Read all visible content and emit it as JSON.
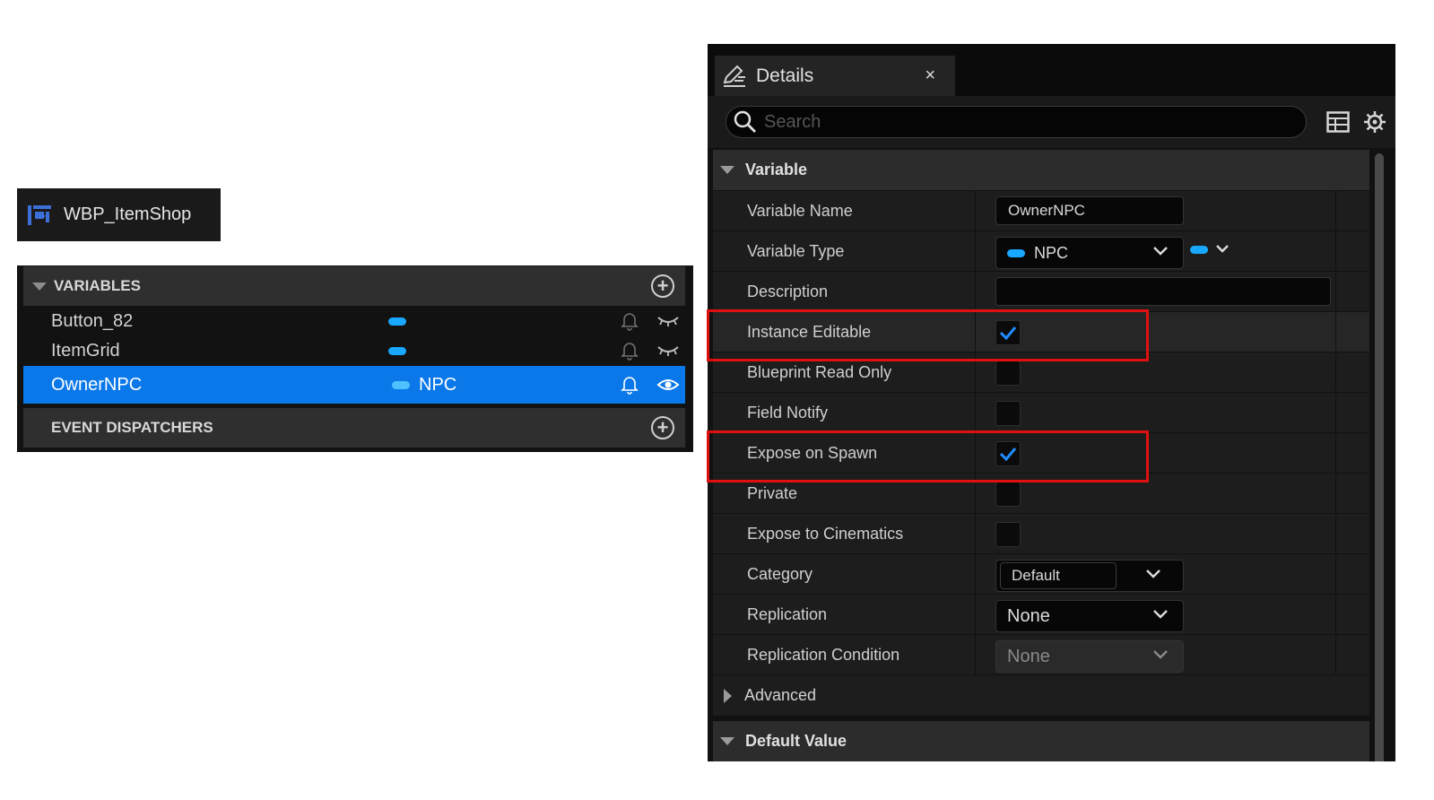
{
  "blueprint_tab": {
    "title": "WBP_ItemShop",
    "icon": "widget-blueprint-icon"
  },
  "my_blueprint": {
    "variables_header": "VARIABLES",
    "variables": [
      {
        "name": "Button_82",
        "type": "",
        "selected": false,
        "visibility": "eye-closed"
      },
      {
        "name": "ItemGrid",
        "type": "",
        "selected": false,
        "visibility": "eye-closed"
      },
      {
        "name": "OwnerNPC",
        "type": "NPC",
        "selected": true,
        "visibility": "eye-open"
      }
    ],
    "event_dispatchers_header": "EVENT DISPATCHERS",
    "accent_color": "#0a78e8",
    "type_pill_color": "#19a8ff"
  },
  "details": {
    "tab_title": "Details",
    "close_glyph": "×",
    "search_placeholder": "Search",
    "section_variable": "Variable",
    "properties": {
      "variable_name": {
        "label": "Variable Name",
        "value": "OwnerNPC"
      },
      "variable_type": {
        "label": "Variable Type",
        "value": "NPC"
      },
      "description": {
        "label": "Description",
        "value": ""
      },
      "instance_editable": {
        "label": "Instance Editable",
        "checked": true
      },
      "blueprint_read_only": {
        "label": "Blueprint Read Only",
        "checked": false
      },
      "field_notify": {
        "label": "Field Notify",
        "checked": false
      },
      "expose_on_spawn": {
        "label": "Expose on Spawn",
        "checked": true
      },
      "private": {
        "label": "Private",
        "checked": false
      },
      "expose_to_cinematics": {
        "label": "Expose to Cinematics",
        "checked": false
      },
      "category": {
        "label": "Category",
        "value": "Default"
      },
      "replication": {
        "label": "Replication",
        "value": "None"
      },
      "replication_condition": {
        "label": "Replication Condition",
        "value": "None"
      }
    },
    "section_advanced": "Advanced",
    "section_default_value": "Default Value",
    "highlight_color": "#e01010",
    "check_color": "#1f8cff"
  }
}
